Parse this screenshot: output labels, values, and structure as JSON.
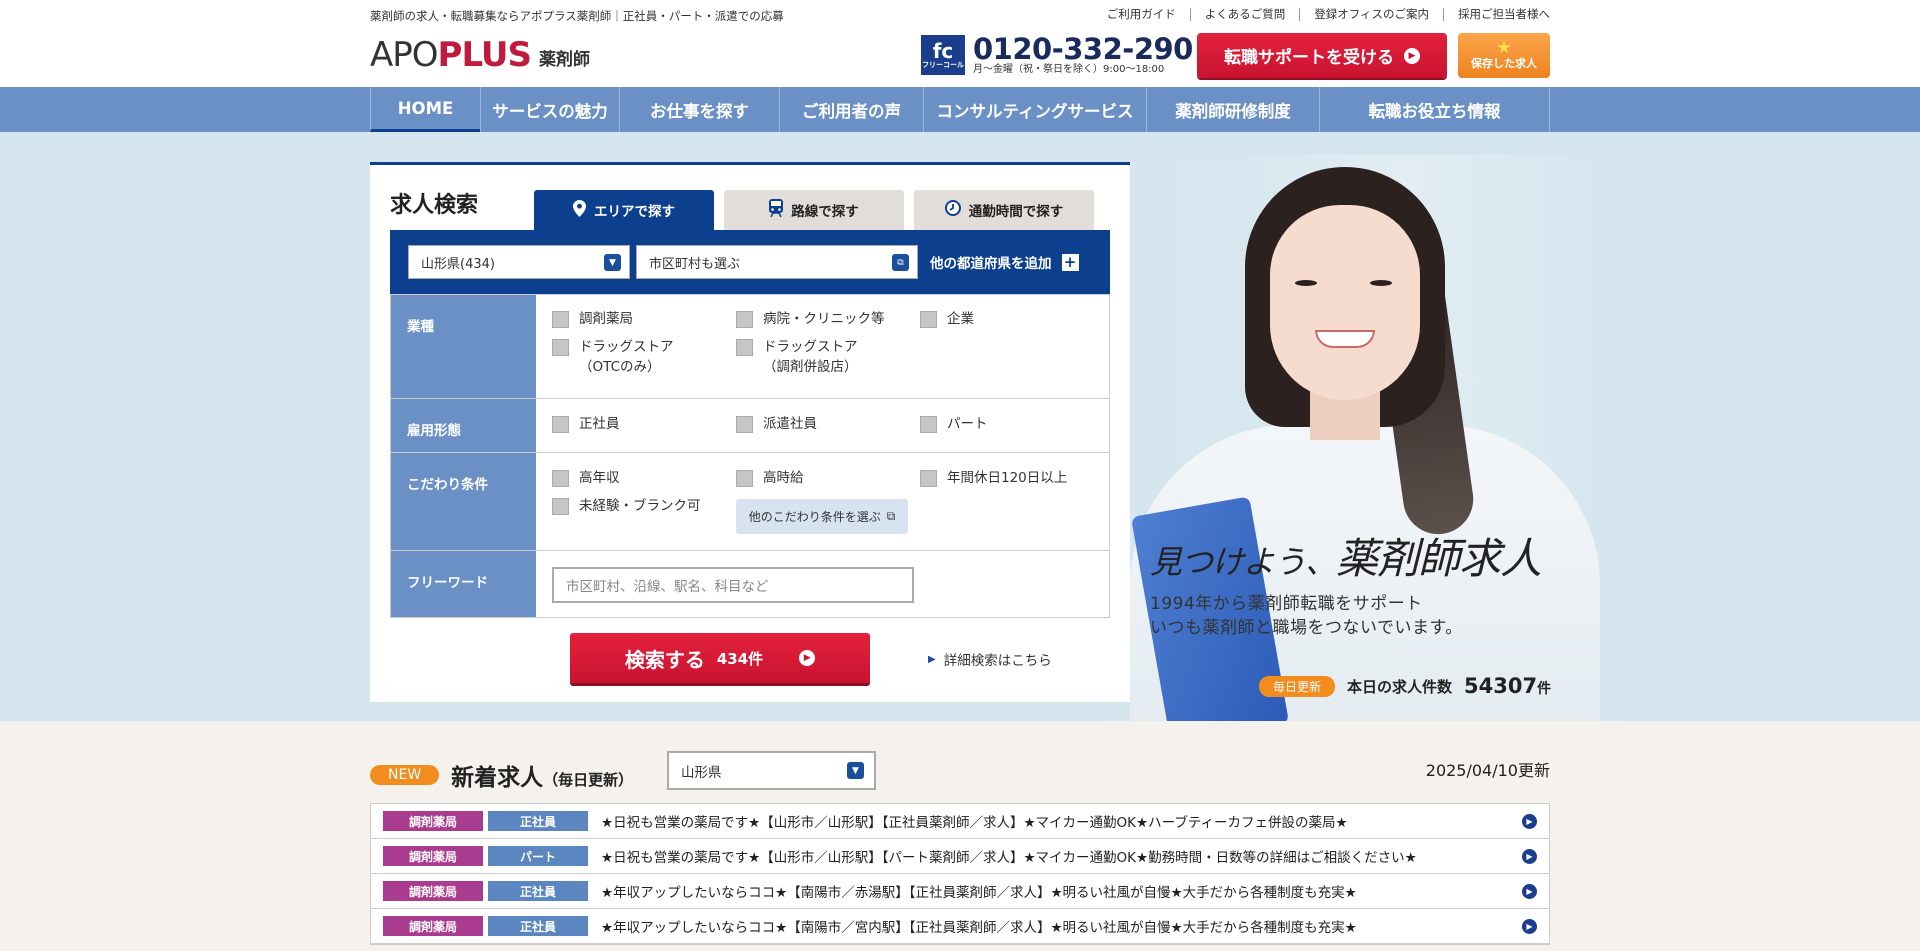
{
  "header": {
    "tagline": "薬剤師の求人・転職募集ならアポプラス薬剤師｜正社員・パート・派遣での応募",
    "links": [
      "ご利用ガイド",
      "よくあるご質問",
      "登録オフィスのご案内",
      "採用ご担当者様へ"
    ],
    "logo_text_a": "APO",
    "logo_text_b": "PLUS",
    "logo_sub": "薬剤師",
    "fc_badge": "fc",
    "fc_small": "フリーコール",
    "phone": "0120-332-290",
    "phone_hours": "月〜金曜（祝・祭日を除く）9:00〜18:00",
    "cta_label": "転職サポートを受ける",
    "saved_label": "保存した求人"
  },
  "nav": {
    "items": [
      "HOME",
      "サービスの魅力",
      "お仕事を探す",
      "ご利用者の声",
      "コンサルティングサービス",
      "薬剤師研修制度",
      "転職お役立ち情報"
    ]
  },
  "hero": {
    "title_a": "見つけよう、",
    "title_b": "薬剤師求人",
    "line1": "1994年から薬剤師転職をサポート",
    "line2": "いつも薬剤師と職場をつないでいます。",
    "daily_badge": "毎日更新",
    "count_label": "本日の求人件数",
    "count_value": "54307",
    "count_unit": "件"
  },
  "search": {
    "title": "求人検索",
    "tabs": [
      "エリアで探す",
      "路線で探す",
      "通勤時間で探す"
    ],
    "prefecture": "山形県(434)",
    "city_placeholder": "市区町村も選ぶ",
    "add_prefecture": "他の都道府県を追加",
    "rows": {
      "industry_label": "業種",
      "industry": [
        "調剤薬局",
        "病院・クリニック等",
        "企業",
        "ドラッグストア\n（OTCのみ）",
        "ドラッグストア\n（調剤併設店）"
      ],
      "employment_label": "雇用形態",
      "employment": [
        "正社員",
        "派遣社員",
        "パート"
      ],
      "preference_label": "こだわり条件",
      "preference": [
        "高年収",
        "高時給",
        "年間休日120日以上",
        "未経験・ブランク可"
      ],
      "more_conditions": "他のこだわり条件を選ぶ",
      "freeword_label": "フリーワード",
      "freeword_placeholder": "市区町村、沿線、駅名、科目など"
    },
    "search_button": "検索する",
    "search_count": "434件",
    "detail_link": "詳細検索はこちら"
  },
  "new_jobs": {
    "badge": "NEW",
    "title": "新着求人",
    "title_note": "（毎日更新）",
    "region": "山形県",
    "updated": "2025/04/10更新",
    "items": [
      {
        "tag1": "調剤薬局",
        "tag2": "正社員",
        "text": "★日祝も営業の薬局です★【山形市／山形駅】【正社員薬剤師／求人】★マイカー通勤OK★ハーブティーカフェ併設の薬局★"
      },
      {
        "tag1": "調剤薬局",
        "tag2": "パート",
        "text": "★日祝も営業の薬局です★【山形市／山形駅】【パート薬剤師／求人】★マイカー通勤OK★勤務時間・日数等の詳細はご相談ください★"
      },
      {
        "tag1": "調剤薬局",
        "tag2": "正社員",
        "text": "★年収アップしたいならココ★【南陽市／赤湯駅】【正社員薬剤師／求人】★明るい社風が自慢★大手だから各種制度も充実★"
      },
      {
        "tag1": "調剤薬局",
        "tag2": "正社員",
        "text": "★年収アップしたいならココ★【南陽市／宮内駅】【正社員薬剤師／求人】★明るい社風が自慢★大手だから各種制度も充実★"
      }
    ]
  },
  "colors": {
    "brand_blue": "#0d3f8f",
    "nav_blue": "#6a90c6",
    "accent_red": "#c81330",
    "accent_orange": "#f28c1f"
  }
}
